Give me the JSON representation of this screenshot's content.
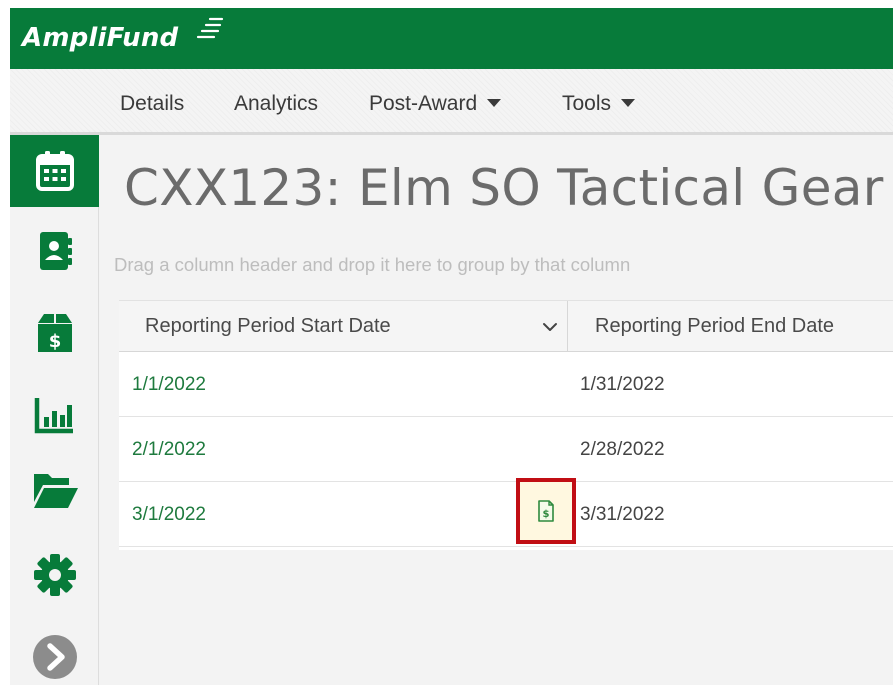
{
  "app": {
    "brand": "AmpliFund",
    "colors": {
      "brand_green": "#077b3a",
      "highlight_red": "#c10e14",
      "link_green": "#1e7a3e"
    }
  },
  "nav": {
    "items": [
      {
        "label": "Details"
      },
      {
        "label": "Analytics"
      },
      {
        "label": "Post-Award",
        "dropdown": true
      },
      {
        "label": "Tools",
        "dropdown": true
      }
    ]
  },
  "sidebar": {
    "items": [
      {
        "icon": "calendar-icon",
        "active": true
      },
      {
        "icon": "contacts-icon"
      },
      {
        "icon": "grant-box-icon"
      },
      {
        "icon": "bar-chart-icon"
      },
      {
        "icon": "folder-open-icon"
      },
      {
        "icon": "gear-icon"
      },
      {
        "icon": "chevron-right-circle-icon"
      }
    ]
  },
  "page": {
    "title": "CXX123: Elm SO Tactical Gear"
  },
  "grid": {
    "group_hint": "Drag a column header and drop it here to group by that column",
    "columns": [
      {
        "label": "Reporting Period Start Date",
        "sortable_menu": true
      },
      {
        "label": "Reporting Period End Date"
      }
    ],
    "rows": [
      {
        "start": "1/1/2022",
        "end": "1/31/2022"
      },
      {
        "start": "2/1/2022",
        "end": "2/28/2022"
      },
      {
        "start": "3/1/2022",
        "end": "3/31/2022",
        "has_financial_report": true
      }
    ],
    "highlighted_icon": "financial-report-icon"
  }
}
